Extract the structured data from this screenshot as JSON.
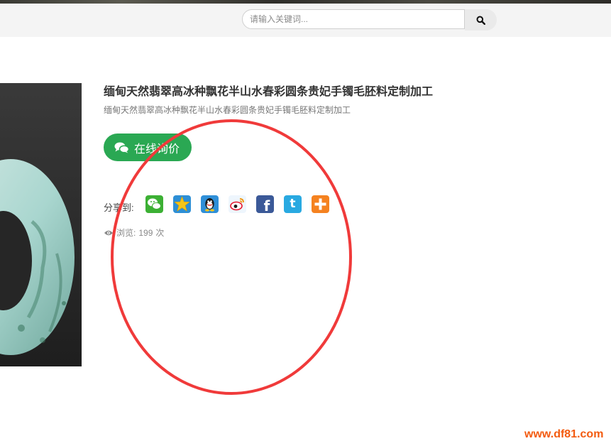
{
  "search": {
    "placeholder": "请输入关键词...",
    "icon": "search-icon"
  },
  "product": {
    "title": "缅甸天然翡翠高冰种飘花半山水春彩圆条贵妃手镯毛胚料定制加工",
    "subtitle": "缅甸天然翡翠高冰种飘花半山水春彩圆条贵妃手镯毛胚料定制加工",
    "inquiry_label": "在线询价",
    "accent_color": "#2aa853"
  },
  "share": {
    "label": "分享到:",
    "icons": [
      "wechat-icon",
      "qzone-icon",
      "qq-icon",
      "weibo-icon",
      "facebook-icon",
      "twitter-icon",
      "more-icon"
    ]
  },
  "views": {
    "label": "浏览:",
    "count": "199",
    "unit": "次"
  },
  "annotation": {
    "color": "#f03a3a"
  },
  "watermark": {
    "text": "www.df81.com"
  }
}
